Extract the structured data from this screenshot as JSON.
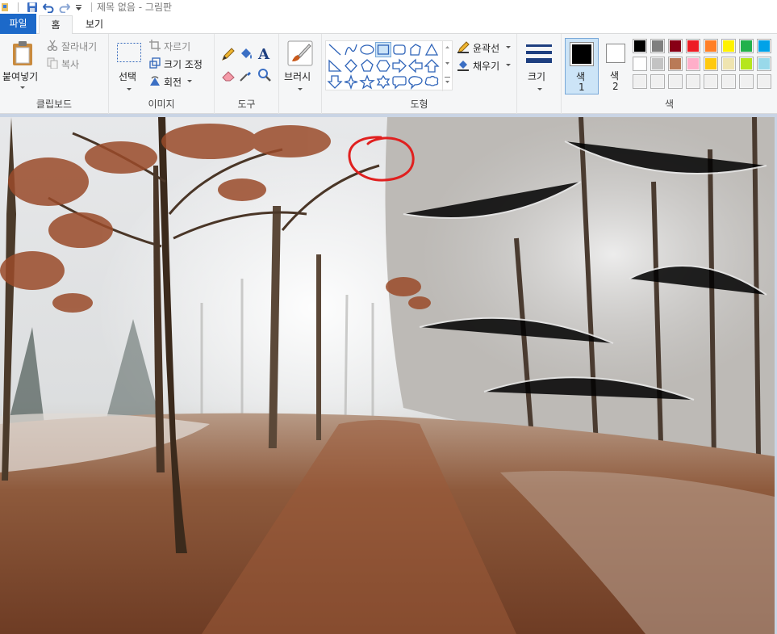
{
  "window": {
    "title": "제목 없음 - 그림판"
  },
  "tabs": [
    {
      "label": "파일",
      "active": false
    },
    {
      "label": "홈",
      "active": true
    },
    {
      "label": "보기",
      "active": false
    }
  ],
  "clipboard": {
    "group_label": "클립보드",
    "paste_label": "붙여넣기",
    "cut_label": "잘라내기",
    "copy_label": "복사"
  },
  "image": {
    "group_label": "이미지",
    "select_label": "선택",
    "crop_label": "자르기",
    "resize_label": "크기 조정",
    "rotate_label": "회전"
  },
  "tools": {
    "group_label": "도구"
  },
  "brushes": {
    "label": "브러시"
  },
  "shapes": {
    "group_label": "도형",
    "outline_label": "윤곽선",
    "fill_label": "채우기",
    "selected_shape": "rectangle"
  },
  "size": {
    "label": "크기"
  },
  "colors": {
    "group_label": "색",
    "color1_label": "색",
    "color1_number": "1",
    "color2_label": "색",
    "color2_number": "2",
    "color1_value": "#000000",
    "color2_value": "#ffffff",
    "palette_row1": [
      "#000000",
      "#7f7f7f",
      "#880015",
      "#ed1c24",
      "#ff7f27",
      "#fff200",
      "#22b14c",
      "#00a2e8"
    ],
    "palette_row2": [
      "#ffffff",
      "#c3c3c3",
      "#b97a57",
      "#ffaec9",
      "#ffc90e",
      "#efe4b0",
      "#b5e61d",
      "#99d9ea"
    ],
    "palette_row3": [
      "#f0f0f0",
      "#f0f0f0",
      "#f0f0f0",
      "#f0f0f0",
      "#f0f0f0",
      "#f0f0f0",
      "#f0f0f0",
      "#f0f0f0"
    ]
  },
  "annotation": {
    "color": "#e0201f"
  }
}
